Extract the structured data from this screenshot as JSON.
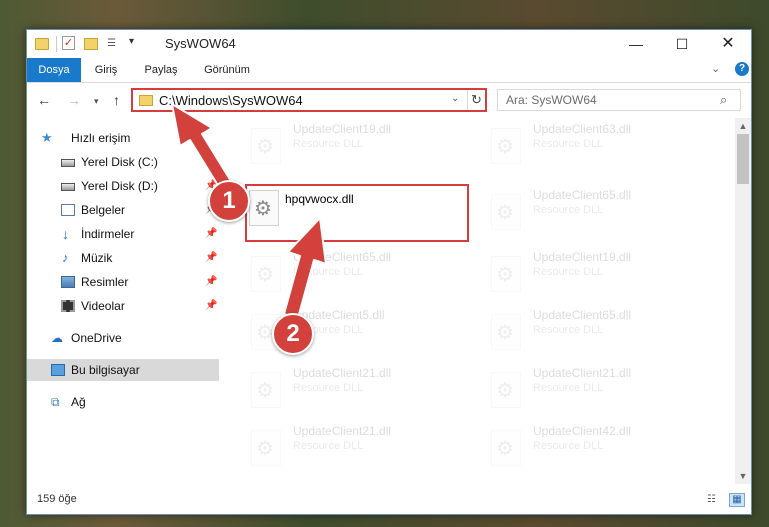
{
  "window": {
    "title": "SysWOW64"
  },
  "ribbon": {
    "tabs": [
      "Dosya",
      "Giriş",
      "Paylaş",
      "Görünüm"
    ],
    "help_label": "?"
  },
  "nav": {
    "address": "C:\\Windows\\SysWOW64",
    "search_placeholder": "Ara: SysWOW64"
  },
  "sidebar": {
    "items": [
      {
        "label": "Hızlı erişim",
        "icon": "star-icon"
      },
      {
        "label": "Yerel Disk (C:)",
        "icon": "drive-icon"
      },
      {
        "label": "Yerel Disk (D:)",
        "icon": "drive-icon"
      },
      {
        "label": "Belgeler",
        "icon": "documents-icon"
      },
      {
        "label": "İndirmeler",
        "icon": "download-icon"
      },
      {
        "label": "Müzik",
        "icon": "music-icon"
      },
      {
        "label": "Resimler",
        "icon": "pictures-icon"
      },
      {
        "label": "Videolar",
        "icon": "videos-icon"
      },
      {
        "label": "OneDrive",
        "icon": "cloud-icon"
      },
      {
        "label": "Bu bilgisayar",
        "icon": "computer-icon"
      },
      {
        "label": "Ağ",
        "icon": "network-icon"
      }
    ],
    "selected": "Bu bilgisayar"
  },
  "files": {
    "left_column": [
      {
        "name": "UpdateClient19.dll",
        "type": "Resource DLL"
      },
      {
        "name": "hpqvwocx.dll",
        "type": ""
      },
      {
        "name": "UpdateClient65.dll",
        "type": "Resource DLL"
      },
      {
        "name": "UpdateClient5.dll",
        "type": "Resource DLL"
      },
      {
        "name": "UpdateClient21.dll",
        "type": "Resource DLL"
      },
      {
        "name": "UpdateClient21.dll",
        "type": "Resource DLL"
      }
    ],
    "right_column": [
      {
        "name": "UpdateClient63.dll",
        "type": "Resource DLL"
      },
      {
        "name": "UpdateClient65.dll",
        "type": "Resource DLL"
      },
      {
        "name": "UpdateClient19.dll",
        "type": "Resource DLL"
      },
      {
        "name": "UpdateClient65.dll",
        "type": "Resource DLL"
      },
      {
        "name": "UpdateClient21.dll",
        "type": "Resource DLL"
      },
      {
        "name": "UpdateClient42.dll",
        "type": "Resource DLL"
      }
    ]
  },
  "status": {
    "item_count": "159 öğe"
  },
  "annotations": {
    "step1": "1",
    "step2": "2",
    "color": "#d2413b"
  }
}
